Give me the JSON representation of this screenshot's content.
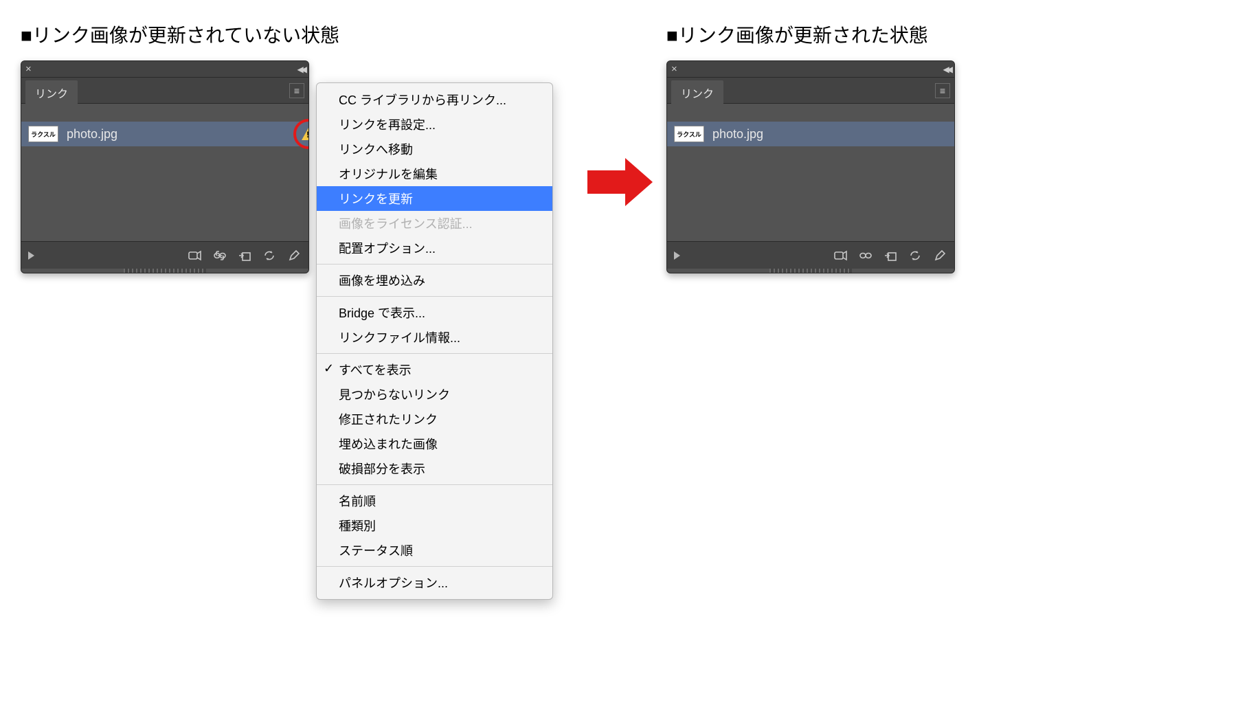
{
  "left": {
    "heading": "■リンク画像が更新されていない状態",
    "panel": {
      "tab_label": "リンク",
      "filename": "photo.jpg",
      "thumb_text": "ラクスル",
      "show_warning": true
    }
  },
  "right": {
    "heading": "■リンク画像が更新された状態",
    "panel": {
      "tab_label": "リンク",
      "filename": "photo.jpg",
      "thumb_text": "ラクスル",
      "show_warning": false
    }
  },
  "menu": {
    "items": [
      {
        "label": "CC ライブラリから再リンク...",
        "state": "normal"
      },
      {
        "label": "リンクを再設定...",
        "state": "normal"
      },
      {
        "label": "リンクへ移動",
        "state": "normal"
      },
      {
        "label": "オリジナルを編集",
        "state": "normal"
      },
      {
        "label": "リンクを更新",
        "state": "highlighted"
      },
      {
        "label": "画像をライセンス認証...",
        "state": "disabled"
      },
      {
        "label": "配置オプション...",
        "state": "normal"
      }
    ],
    "group2": [
      {
        "label": "画像を埋め込み",
        "state": "normal"
      }
    ],
    "group3": [
      {
        "label": "Bridge で表示...",
        "state": "normal"
      },
      {
        "label": "リンクファイル情報...",
        "state": "normal"
      }
    ],
    "group4": [
      {
        "label": "すべてを表示",
        "state": "normal",
        "checked": true
      },
      {
        "label": "見つからないリンク",
        "state": "normal"
      },
      {
        "label": "修正されたリンク",
        "state": "normal"
      },
      {
        "label": "埋め込まれた画像",
        "state": "normal"
      },
      {
        "label": "破損部分を表示",
        "state": "normal"
      }
    ],
    "group5": [
      {
        "label": "名前順",
        "state": "normal"
      },
      {
        "label": "種類別",
        "state": "normal"
      },
      {
        "label": "ステータス順",
        "state": "normal"
      }
    ],
    "group6": [
      {
        "label": "パネルオプション...",
        "state": "normal"
      }
    ]
  }
}
